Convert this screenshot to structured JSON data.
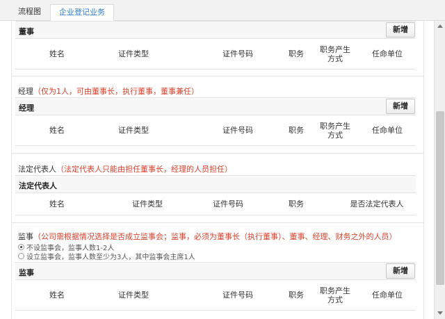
{
  "tabs": [
    {
      "label": "流程图",
      "active": false
    },
    {
      "label": "企业登记业务",
      "active": true
    }
  ],
  "sections": {
    "directors": {
      "bar_label": "董事",
      "add_label": "新增",
      "columns": [
        "姓名",
        "证件类型",
        "证件号码",
        "职务",
        "职务产生\n方式",
        "任命单位"
      ]
    },
    "manager": {
      "title": "经理",
      "note": "（仅为1人，可由董事长，执行董事，董事兼任）",
      "bar_label": "经理",
      "add_label": "新增",
      "columns": [
        "姓名",
        "证件类型",
        "证件号码",
        "职务",
        "职务产生\n方式",
        "任命单位"
      ]
    },
    "legal_rep": {
      "title": "法定代表人",
      "note": "（法定代表人只能由担任董事长，经理的人员担任）",
      "bar_label": "法定代表人",
      "columns": [
        "姓名",
        "证件类型",
        "证件号码",
        "职务",
        "是否法定代表人"
      ]
    },
    "supervisors": {
      "title": "监事",
      "note": "（公司需根据情况选择是否成立监事会；监事，必须为董事长（执行董事）、董事、经理、财务之外的人员）",
      "options": [
        {
          "label": "不设监事会，监事人数1-2人",
          "checked": true
        },
        {
          "label": "设立监事会，监事人数至少为3人，其中监事会主席1人",
          "checked": false
        }
      ],
      "bar_label": "监事",
      "add_label": "新增",
      "columns": [
        "姓名",
        "证件类型",
        "证件号码",
        "职务",
        "职务产生\n方式",
        "任命单位"
      ]
    }
  },
  "colors": {
    "note_red": "#d9412b",
    "tab_active_text": "#2a7bd2",
    "header_bg": "#f7f7f7"
  }
}
